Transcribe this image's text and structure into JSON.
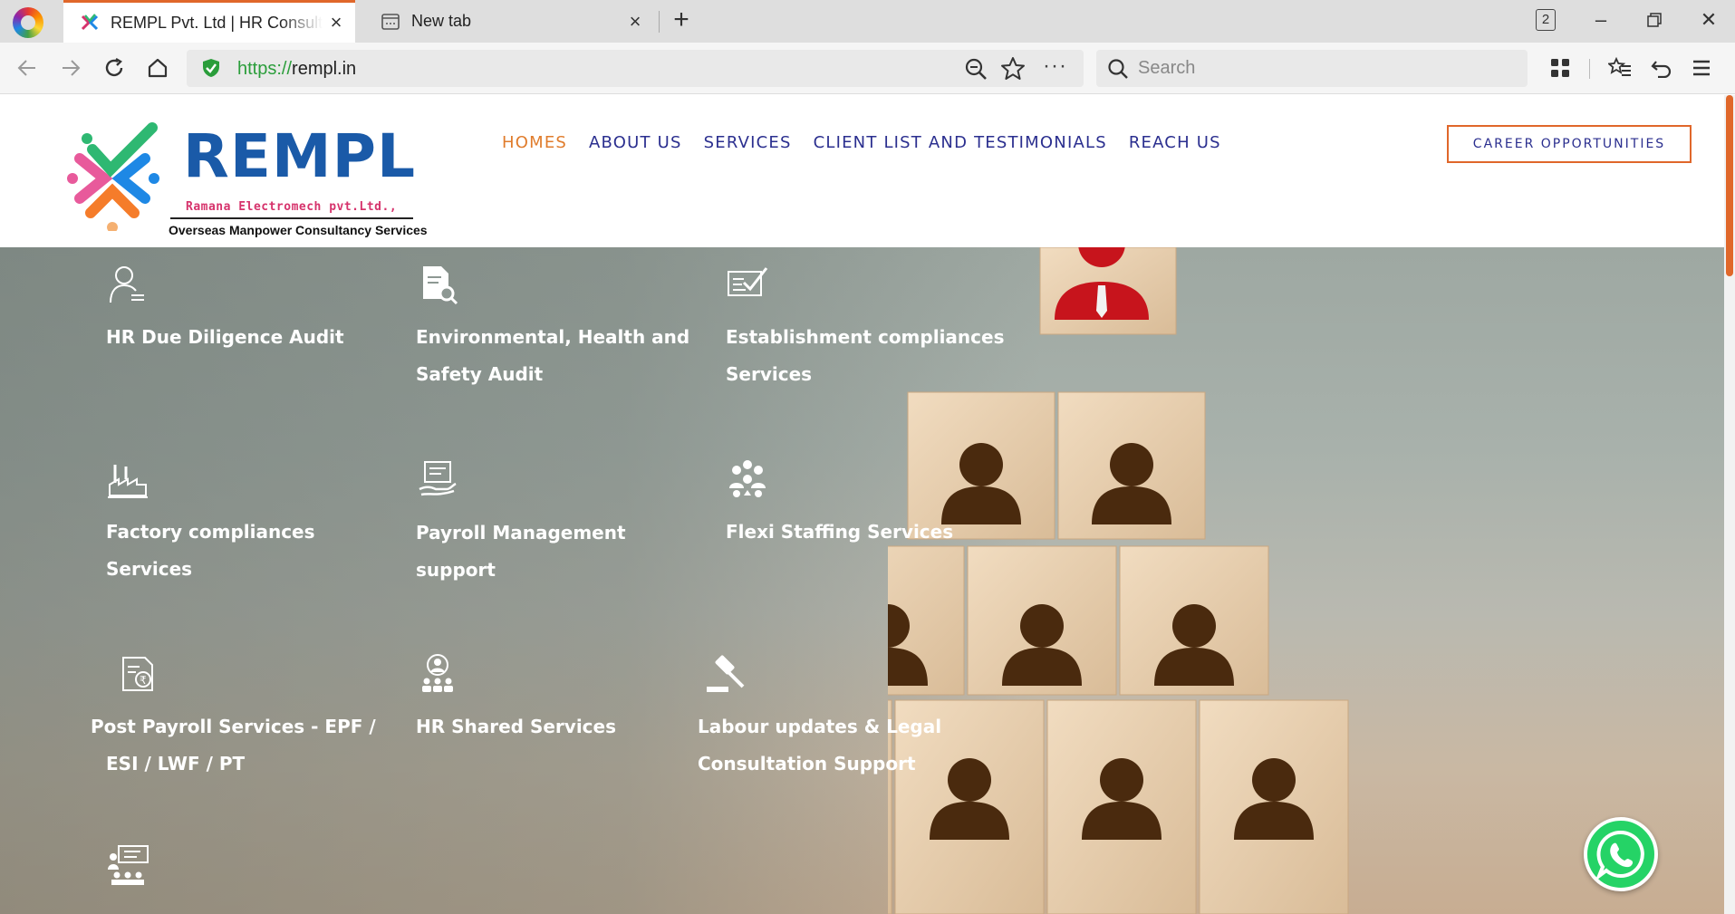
{
  "browser": {
    "tabs": [
      {
        "title": "REMPL Pvt. Ltd | HR Consulting",
        "active": true
      },
      {
        "title": "New tab",
        "active": false
      }
    ],
    "tab_count": "2",
    "url_scheme": "https://",
    "url_host": "rempl.in",
    "search_placeholder": "Search",
    "accent_color": "#e0672a"
  },
  "header": {
    "logo_word": "REMPL",
    "logo_sub": "Ramana Electromech pvt.Ltd.,",
    "logo_tagline": "Overseas Manpower Consultancy Services",
    "nav": [
      {
        "label": "HOMES",
        "active": true
      },
      {
        "label": "ABOUT US",
        "active": false
      },
      {
        "label": "SERVICES",
        "active": false
      },
      {
        "label": "CLIENT LIST AND TESTIMONIALS",
        "active": false
      },
      {
        "label": "REACH US",
        "active": false
      }
    ],
    "career_button": "CAREER OPPORTUNITIES",
    "nav_color": "#2b2f8f",
    "active_color": "#e07c2c"
  },
  "services": [
    {
      "line1": "HR Due Diligence Audit",
      "line2": "",
      "icon": "auditor-icon"
    },
    {
      "line1": "Environmental, Health and",
      "line2": "Safety Audit",
      "icon": "document-search-icon"
    },
    {
      "line1": "Establishment compliances",
      "line2": "Services",
      "icon": "checklist-icon"
    },
    {
      "line1": "Factory compliances",
      "line2": "Services",
      "icon": "factory-icon"
    },
    {
      "line1": "Payroll Management",
      "line2": "support",
      "icon": "payroll-hand-icon"
    },
    {
      "line1": "Flexi Staffing Services",
      "line2": "",
      "icon": "team-icon"
    },
    {
      "line1": "Post Payroll Services - EPF /",
      "line2": "ESI / LWF / PT",
      "icon": "rupee-document-icon"
    },
    {
      "line1": "HR Shared Services",
      "line2": "",
      "icon": "shared-people-icon"
    },
    {
      "line1": "Labour updates & Legal",
      "line2": "Consultation Support",
      "icon": "gavel-icon"
    },
    {
      "line1": "",
      "line2": "",
      "icon": "training-icon"
    }
  ]
}
